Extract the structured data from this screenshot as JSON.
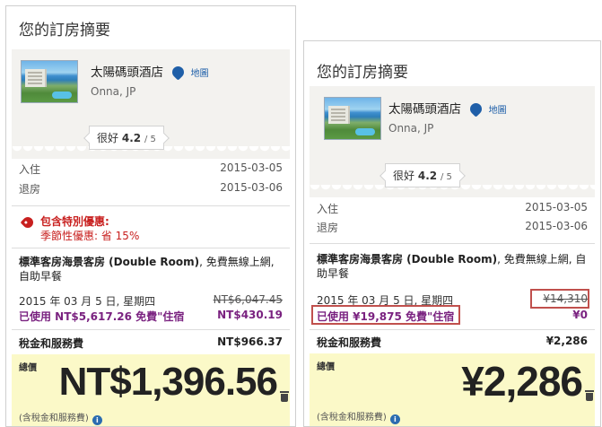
{
  "left": {
    "title": "您的訂房摘要",
    "hotel": {
      "name": "太陽碼頭酒店",
      "map_link": "地圖",
      "location": "Onna, JP"
    },
    "rating": {
      "label": "很好",
      "score": "4.2",
      "out_of": "/ 5"
    },
    "checkin": {
      "label": "入住",
      "value": "2015-03-05"
    },
    "checkout": {
      "label": "退房",
      "value": "2015-03-06"
    },
    "promo": {
      "title": "包含特別優惠:",
      "detail": "季節性優惠: 省 15%"
    },
    "room": {
      "name": "標準客房海景客房 (Double Room)",
      "amenities": ", 免費無線上網, 自助早餐"
    },
    "night": {
      "date": "2015 年 03 月 5 日, 星期四",
      "original_price": "NT$6,047.45"
    },
    "free_night": {
      "label": "已使用 NT$5,617.26 免費\"住宿",
      "remaining": "NT$430.19"
    },
    "tax": {
      "label": "稅金和服務費",
      "value": "NT$966.37"
    },
    "total": {
      "label": "總價",
      "amount": "NT$1,396.56",
      "note": "(含稅金和服務費)"
    }
  },
  "right": {
    "title": "您的訂房摘要",
    "hotel": {
      "name": "太陽碼頭酒店",
      "map_link": "地圖",
      "location": "Onna, JP"
    },
    "rating": {
      "label": "很好",
      "score": "4.2",
      "out_of": "/ 5"
    },
    "checkin": {
      "label": "入住",
      "value": "2015-03-05"
    },
    "checkout": {
      "label": "退房",
      "value": "2015-03-06"
    },
    "room": {
      "name": "標準客房海景客房 (Double Room)",
      "amenities": ", 免費無線上網, 自助早餐"
    },
    "night": {
      "date": "2015 年 03 月 5 日, 星期四",
      "original_price": "¥14,310"
    },
    "free_night": {
      "label": "已使用 ¥19,875 免費\"住宿",
      "remaining": "¥0"
    },
    "tax": {
      "label": "稅金和服務費",
      "value": "¥2,286"
    },
    "total": {
      "label": "總價",
      "amount": "¥2,286",
      "note": "(含稅金和服務費)"
    }
  },
  "colors": {
    "promo": "#c8201f",
    "free_night": "#7a2280",
    "highlight_box": "#c0504d",
    "total_bg": "#fbf9c8"
  }
}
